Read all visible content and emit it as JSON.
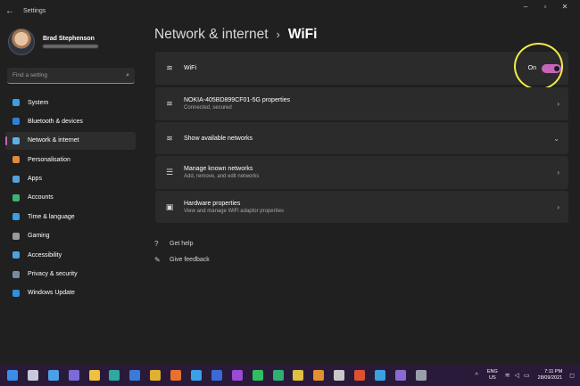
{
  "window": {
    "back_glyph": "←",
    "title": "Settings",
    "minimize_glyph": "–",
    "maximize_glyph": "▫",
    "close_glyph": "✕"
  },
  "profile": {
    "name": "Brad Stephenson"
  },
  "search": {
    "placeholder": "Find a setting",
    "icon": "search-icon",
    "glyph": "⌕"
  },
  "sidebar": {
    "items": [
      {
        "label": "System",
        "icon": "system-icon",
        "color": "#3a9ee8"
      },
      {
        "label": "Bluetooth & devices",
        "icon": "bluetooth-icon",
        "color": "#2f7fd9"
      },
      {
        "label": "Network & internet",
        "icon": "network-icon",
        "color": "#5fb0e8",
        "active": true
      },
      {
        "label": "Personalisation",
        "icon": "brush-icon",
        "color": "#e08a3c"
      },
      {
        "label": "Apps",
        "icon": "apps-icon",
        "color": "#55a0d8"
      },
      {
        "label": "Accounts",
        "icon": "accounts-icon",
        "color": "#3cb371"
      },
      {
        "label": "Time & language",
        "icon": "globe-icon",
        "color": "#3a9ee8"
      },
      {
        "label": "Gaming",
        "icon": "gaming-icon",
        "color": "#9a9a9a"
      },
      {
        "label": "Accessibility",
        "icon": "accessibility-icon",
        "color": "#4aa3e0"
      },
      {
        "label": "Privacy & security",
        "icon": "shield-icon",
        "color": "#7a8a9a"
      },
      {
        "label": "Windows Update",
        "icon": "update-icon",
        "color": "#2f8fe0"
      }
    ]
  },
  "breadcrumb": {
    "parent": "Network & internet",
    "separator": "›",
    "current": "WiFi"
  },
  "cards": {
    "wifi": {
      "title": "WiFi",
      "toggle_label": "On",
      "toggle_on": true,
      "icon": "wifi-icon",
      "glyph": "≋"
    },
    "properties": {
      "title": "NOKIA-405BD899CF01-5G properties",
      "subtitle": "Connected, secured",
      "icon": "wifi-secured-icon",
      "glyph": "≋"
    },
    "available": {
      "title": "Show available networks",
      "icon": "wifi-list-icon",
      "glyph": "≋"
    },
    "known": {
      "title": "Manage known networks",
      "subtitle": "Add, remove, and edit networks",
      "icon": "list-icon",
      "glyph": "☰"
    },
    "hardware": {
      "title": "Hardware properties",
      "subtitle": "View and manage WiFi adaptor properties",
      "icon": "chip-icon",
      "glyph": "▣"
    }
  },
  "chevrons": {
    "right": "›",
    "down": "⌄"
  },
  "help": {
    "get_help": "Get help",
    "get_help_glyph": "?",
    "feedback": "Give feedback",
    "feedback_glyph": "✎"
  },
  "taskbar": {
    "icons": [
      {
        "name": "start-icon",
        "color": "#3a8ee6"
      },
      {
        "name": "search-taskbar-icon",
        "color": "#c9c9d9"
      },
      {
        "name": "task-view-icon",
        "color": "#4aa0e8"
      },
      {
        "name": "teams-icon",
        "color": "#7b6bd6"
      },
      {
        "name": "file-explorer-icon",
        "color": "#f0c040"
      },
      {
        "name": "edge-icon",
        "color": "#2fa8a0"
      },
      {
        "name": "store-icon",
        "color": "#3a7ad9"
      },
      {
        "name": "chrome-icon",
        "color": "#e0b030"
      },
      {
        "name": "firefox-icon",
        "color": "#e87030"
      },
      {
        "name": "app-blue-icon",
        "color": "#3aa0e8"
      },
      {
        "name": "word-icon",
        "color": "#3a6ad6"
      },
      {
        "name": "onenote-icon",
        "color": "#9a4ad6"
      },
      {
        "name": "spotify-icon",
        "color": "#2ec060"
      },
      {
        "name": "app-green-icon",
        "color": "#2eb070"
      },
      {
        "name": "app-yellow-icon",
        "color": "#e0c040"
      },
      {
        "name": "app-orange-icon",
        "color": "#e09030"
      },
      {
        "name": "app-tile-icon",
        "color": "#c8c8c8"
      },
      {
        "name": "brave-icon",
        "color": "#e05030"
      },
      {
        "name": "telegram-icon",
        "color": "#3aa0e0"
      },
      {
        "name": "media-player-icon",
        "color": "#8a6ad0"
      },
      {
        "name": "settings-taskbar-icon",
        "color": "#9aa0aa"
      }
    ],
    "tray_chevron": "^",
    "lang_top": "ENG",
    "lang_bottom": "US",
    "wifi_glyph": "≋",
    "volume_glyph": "◁",
    "battery_glyph": "▭",
    "time": "7:11 PM",
    "date": "28/09/2021",
    "notify_glyph": "◻"
  }
}
